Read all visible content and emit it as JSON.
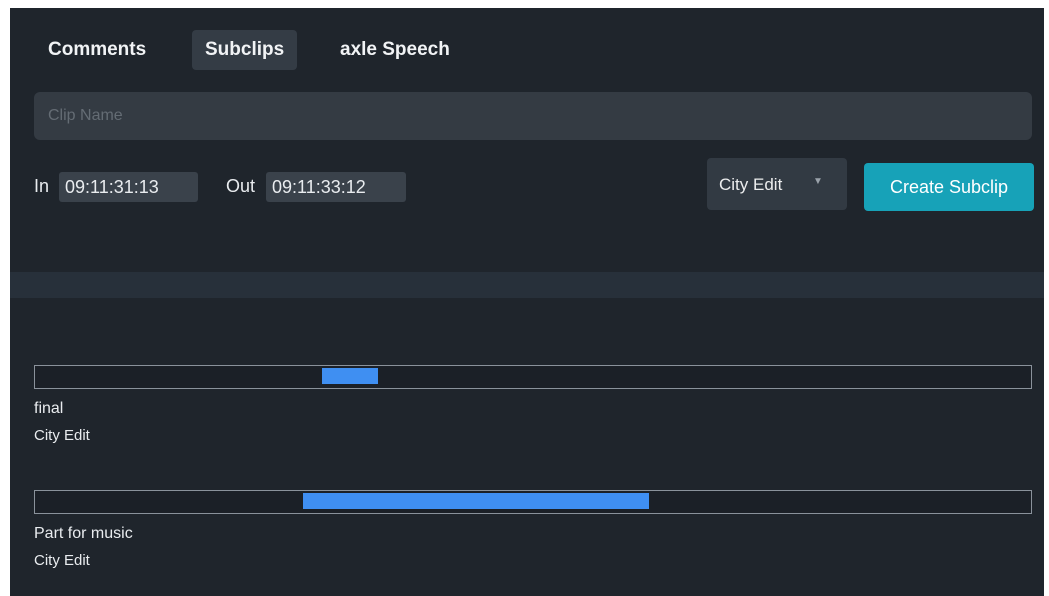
{
  "tabs": [
    {
      "label": "Comments",
      "active": false
    },
    {
      "label": "Subclips",
      "active": true
    },
    {
      "label": "axle Speech",
      "active": false
    }
  ],
  "clip_name": {
    "placeholder": "Clip Name",
    "value": ""
  },
  "timecode": {
    "in_label": "In",
    "in_value": "09:11:31:13",
    "out_label": "Out",
    "out_value": "09:11:33:12"
  },
  "edit_select": {
    "selected": "City Edit"
  },
  "create_button": {
    "label": "Create Subclip"
  },
  "colors": {
    "panel_bg": "#1f252c",
    "accent": "#17a2b8",
    "range_fill": "#3f8ff2"
  },
  "subclips": [
    {
      "name": "final",
      "edit": "City Edit",
      "range_start": 0.288,
      "range_end": 0.344
    },
    {
      "name": "Part for music",
      "edit": "City Edit",
      "range_start": 0.269,
      "range_end": 0.616
    }
  ]
}
